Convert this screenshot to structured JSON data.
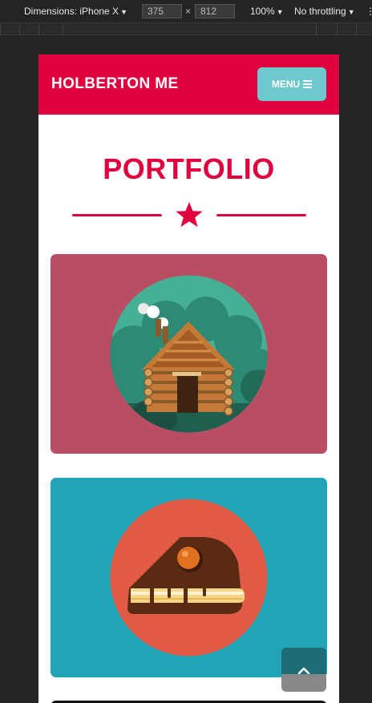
{
  "devtools": {
    "dimensions_label": "Dimensions: iPhone X",
    "width_value": "375",
    "times_sign": "×",
    "height_value": "812",
    "zoom": "100%",
    "throttling": "No throttling",
    "more_menu": "⋮"
  },
  "header": {
    "brand": "HOLBERTON ME",
    "menu_label": "MENU"
  },
  "main": {
    "title": "PORTFOLIO"
  },
  "portfolio": {
    "items": [
      {
        "icon": "log-cabin-icon",
        "background": "#b94d64"
      },
      {
        "icon": "cake-slice-icon",
        "background": "#21a5b6"
      }
    ]
  },
  "colors": {
    "accent": "#e0023e",
    "menu_button": "#6ec9cf"
  }
}
